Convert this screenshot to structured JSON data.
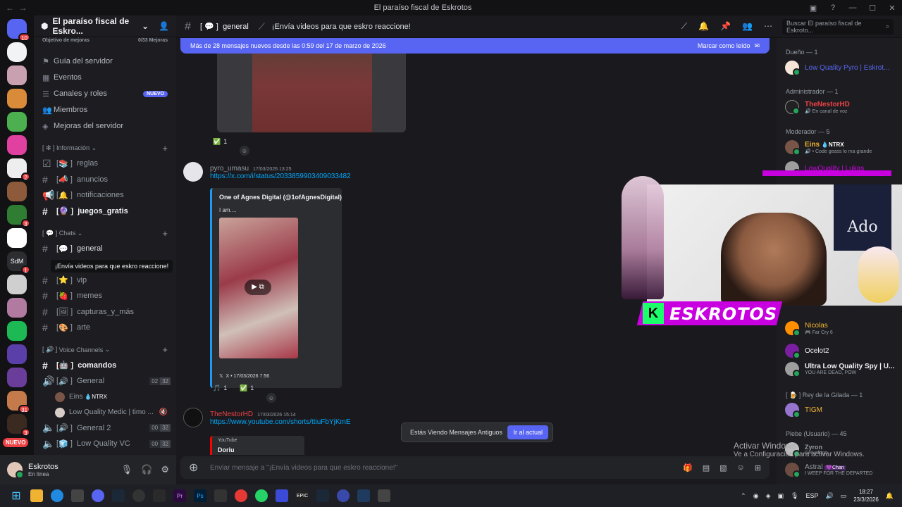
{
  "window": {
    "title": "El paraíso fiscal de Eskrotos"
  },
  "guilds": {
    "badges": [
      "10",
      "2",
      "3",
      "1",
      "3",
      "31",
      "3"
    ],
    "sdm_label": "SdM",
    "new_label": "NUEVO"
  },
  "server": {
    "name": "El paraíso fiscal de Eskro...",
    "goal_label": "Objetivo de mejoras",
    "goal_progress": "0/33 Mejoras",
    "menu": [
      {
        "label": "Guía del servidor",
        "icon": "signpost-icon"
      },
      {
        "label": "Eventos",
        "icon": "calendar-icon"
      },
      {
        "label": "Canales y roles",
        "icon": "channels-icon",
        "badge": "NUEVO"
      },
      {
        "label": "Miembros",
        "icon": "members-icon"
      },
      {
        "label": "Mejoras del servidor",
        "icon": "boost-icon"
      }
    ],
    "categories": {
      "info": "Información",
      "chats": "Chats",
      "voice": "Voice Channels"
    },
    "info_channels": [
      {
        "prefix": "[",
        "emoji": "📚",
        "name": "reglas"
      },
      {
        "prefix": "[",
        "emoji": "📣",
        "name": "anuncios"
      },
      {
        "prefix": "[",
        "emoji": "🔔",
        "name": "notificaciones"
      },
      {
        "prefix": "[",
        "emoji": "🔮",
        "name": "juegos_gratis"
      }
    ],
    "chat_channels": [
      {
        "prefix": "[",
        "emoji": "💬",
        "name": "general"
      },
      {
        "prefix": "[",
        "emoji": "⭐",
        "name": "vip"
      },
      {
        "prefix": "[",
        "emoji": "🍓",
        "name": "memes"
      },
      {
        "prefix": "[",
        "emoji": "🖼",
        "name": "capturas_y_más"
      },
      {
        "prefix": "[",
        "emoji": "🎨",
        "name": "arte"
      }
    ],
    "voice": {
      "commands": {
        "prefix": "[",
        "emoji": "🤖",
        "name": "comandos"
      },
      "general": {
        "prefix": "[",
        "emoji": "🔊",
        "name": "General",
        "count_a": "02",
        "count_b": "32"
      },
      "users": [
        {
          "name": "Eins",
          "tag": "💧NTRX"
        },
        {
          "name": "Low Quality Medic | timo ..."
        }
      ],
      "general2": {
        "prefix": "[",
        "emoji": "🔊",
        "name": "General 2",
        "count_a": "00",
        "count_b": "32"
      },
      "lowvc": {
        "prefix": "[",
        "emoji": "🧊",
        "name": "Low Quality VC",
        "count_a": "00",
        "count_b": "32"
      }
    },
    "thread_tooltip": "¡Envía videos para que eskro reaccione!"
  },
  "user": {
    "name": "Eskrotos",
    "status": "En línea"
  },
  "topbar": {
    "channel_prefix": "[",
    "channel_emoji": "💬",
    "channel_name": "general",
    "topic": "¡Envía videos para que eskro reaccione!",
    "search_placeholder": "Buscar El paraíso fiscal de Eskroto..."
  },
  "banner": {
    "text": "Más de 28 mensajes nuevos desde las 0:59 del 17 de marzo de 2026",
    "action": "Marcar como leído"
  },
  "messages": {
    "first_reaction_count": "1",
    "m1": {
      "author": "pyro_umasu",
      "timestamp": "17/03/2026 13:25",
      "link": "https://x.com/i/status/2033859903409033482",
      "embed_title": "One of Agnes Digital (@1ofAgnesDigital)",
      "embed_text": "I am....",
      "embed_footer": "X • 17/03/2026 7:56",
      "reaction_a": "1",
      "reaction_b": "1"
    },
    "m2": {
      "author": "TheNestorHD",
      "timestamp": "17/03/2026 15:14",
      "link": "https://www.youtube.com/shorts/ttiuFbYjKmE",
      "yt_provider": "YouTube",
      "yt_title": "Doriu"
    },
    "old_notice": "Estás Viendo Mensajes Antiguos",
    "old_button": "Ir al actual"
  },
  "input": {
    "placeholder": "Enviar mensaje a \"¡Envía videos para que eskro reaccione!\""
  },
  "members": {
    "groups": [
      {
        "label": "Dueño — 1"
      },
      {
        "label": "Administrador — 1"
      },
      {
        "label": "Moderador — 5"
      },
      {
        "label": "[ 🍺 ] Rey de la Gilada — 1"
      },
      {
        "label": "Plebe (Usuario) — 45"
      }
    ],
    "list": [
      {
        "name": "Low Quality Pyro | Eskrot...",
        "status": "",
        "color": "#5865f2"
      },
      {
        "name": "TheNestorHD",
        "status": "🔊 En canal de voz",
        "color": "#ed4245"
      },
      {
        "name": "Eins",
        "tag": "💧NTRX",
        "status": "🔊 • Code geass lo ma grande",
        "color": "#f0b232"
      },
      {
        "name": "LowQuality | Lukas",
        "status": "",
        "color": "#c800e0"
      },
      {
        "name": "Nicolas",
        "status": "🎮 Far Cry 6",
        "color": "#f0b232"
      },
      {
        "name": "Ocelot2",
        "status": "",
        "color": "#f2f3f5"
      },
      {
        "name": "Ultra Low Quality Spy | U...",
        "status": "YOU ARE DEAD, POW",
        "color": "#f2f3f5"
      },
      {
        "name": "TIGM",
        "status": "",
        "color": "#f0b232"
      },
      {
        "name": "Zyron",
        "status": "Cervefogo",
        "color": "#949ba4"
      },
      {
        "name": "Astral",
        "tag": "💜Chan",
        "status": "I WEEP FOR THE DEPARTED",
        "color": "#949ba4"
      }
    ]
  },
  "stream_overlay": {
    "brand": "ESKROTOS",
    "poster_text": "Ado"
  },
  "watermark": {
    "line1": "Activar Windows",
    "line2": "Ve a Configuración para activar Windows."
  },
  "taskbar": {
    "lang": "ESP",
    "time": "18:27",
    "date": "23/3/2026"
  }
}
